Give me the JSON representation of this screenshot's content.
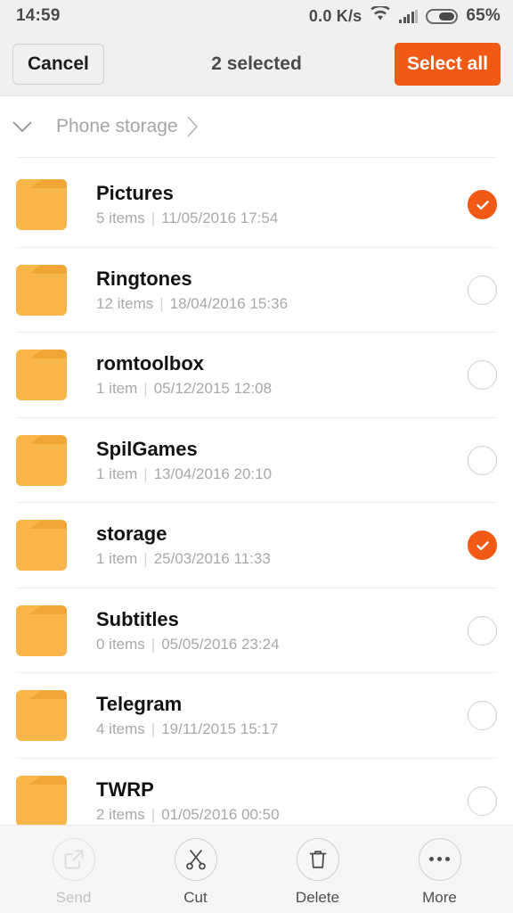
{
  "status_bar": {
    "clock": "14:59",
    "net_speed": "0.0 K/s",
    "wifi_icon": "wifi-icon",
    "signal_icon": "signal-bars-icon",
    "battery_icon": "battery-icon",
    "battery_percent": "65%"
  },
  "action_bar": {
    "cancel_label": "Cancel",
    "title": "2 selected",
    "select_all_label": "Select all",
    "accent_color": "#f05a14"
  },
  "breadcrumb": {
    "expand_icon": "chevron-down-icon",
    "path": "Phone storage",
    "forward_icon": "chevron-right-icon"
  },
  "files": [
    {
      "name": "Pictures",
      "count": "5 items",
      "separator": "|",
      "date": "11/05/2016 17:54",
      "selected": true
    },
    {
      "name": "Ringtones",
      "count": "12 items",
      "separator": "|",
      "date": "18/04/2016 15:36",
      "selected": false
    },
    {
      "name": "romtoolbox",
      "count": "1 item",
      "separator": "|",
      "date": "05/12/2015 12:08",
      "selected": false
    },
    {
      "name": "SpilGames",
      "count": "1 item",
      "separator": "|",
      "date": "13/04/2016 20:10",
      "selected": false
    },
    {
      "name": "storage",
      "count": "1 item",
      "separator": "|",
      "date": "25/03/2016 11:33",
      "selected": true
    },
    {
      "name": "Subtitles",
      "count": "0 items",
      "separator": "|",
      "date": "05/05/2016 23:24",
      "selected": false
    },
    {
      "name": "Telegram",
      "count": "4 items",
      "separator": "|",
      "date": "19/11/2015 15:17",
      "selected": false
    },
    {
      "name": "TWRP",
      "count": "2 items",
      "separator": "|",
      "date": "01/05/2016 00:50",
      "selected": false
    }
  ],
  "toolbar": {
    "items": [
      {
        "label": "Send",
        "icon": "share-icon",
        "disabled": true
      },
      {
        "label": "Cut",
        "icon": "scissors-icon",
        "disabled": false
      },
      {
        "label": "Delete",
        "icon": "trash-icon",
        "disabled": false
      },
      {
        "label": "More",
        "icon": "more-dots-icon",
        "disabled": false
      }
    ]
  },
  "folder_icon_color": "#f9b64b"
}
